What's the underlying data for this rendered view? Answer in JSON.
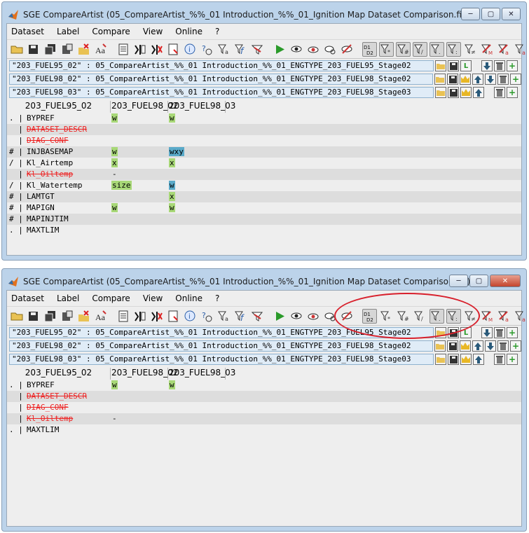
{
  "colors": {
    "added": "#a8d877",
    "changed": "#5aaac9",
    "removed": "#e22222",
    "highlight": "#d8202c"
  },
  "windows": [
    {
      "title": "SGE CompareArtist (05_CompareArtist_%%_01 Introduction_%%_01_Ignition Map Dataset Comparison.fig)",
      "menus": [
        "Dataset",
        "Label",
        "Compare",
        "View",
        "Online",
        "?"
      ],
      "datasets": [
        "\"203_FUEL95_02\" : 05_CompareArtist_%%_01 Introduction_%%_01_ENGTYPE_203_FUEL95_Stage02",
        "\"203_FUEL98_02\" : 05_CompareArtist_%%_01 Introduction_%%_01_ENGTYPE_203_FUEL98_Stage02",
        "\"203_FUEL98_03\" : 05_CompareArtist_%%_01 Introduction_%%_01_ENGTYPE_203_FUEL98_Stage03"
      ],
      "headers": [
        "203_FUEL95_02",
        "203_FUEL98_02",
        "203_FUEL98_03"
      ],
      "rows": [
        {
          "flag": ". |",
          "name": "BYPREF",
          "v1": "w",
          "v1c": "g",
          "v2": "w",
          "v2c": "g",
          "removed": false
        },
        {
          "flag": "  |",
          "name": "DATASET_DESCR",
          "v1": "",
          "v1c": "",
          "v2": "",
          "v2c": "",
          "removed": true
        },
        {
          "flag": "  |",
          "name": "DIAG_CONF",
          "v1": "",
          "v1c": "",
          "v2": "",
          "v2c": "",
          "removed": true
        },
        {
          "flag": "# |",
          "name": "INJBASEMAP",
          "v1": "w",
          "v1c": "g",
          "v2": "wxy",
          "v2c": "b",
          "removed": false
        },
        {
          "flag": "/ |",
          "name": "Kl_Airtemp",
          "v1": "x",
          "v1c": "g",
          "v2": "x",
          "v2c": "g",
          "removed": false
        },
        {
          "flag": "  |",
          "name": "Kl_Oiltemp",
          "v1": "-",
          "v1c": "",
          "v2": "",
          "v2c": "",
          "removed": true
        },
        {
          "flag": "/ |",
          "name": "Kl_Watertemp",
          "v1": "size",
          "v1c": "g",
          "v2": "w",
          "v2c": "b",
          "removed": false
        },
        {
          "flag": "# |",
          "name": "LAMTGT",
          "v1": "",
          "v1c": "",
          "v2": "x",
          "v2c": "g",
          "removed": false
        },
        {
          "flag": "# |",
          "name": "MAPIGN",
          "v1": "w",
          "v1c": "g",
          "v2": "w",
          "v2c": "g",
          "removed": false
        },
        {
          "flag": "# |",
          "name": "MAPINJTIM",
          "v1": "",
          "v1c": "",
          "v2": "",
          "v2c": "",
          "removed": false
        },
        {
          "flag": ". |",
          "name": "MAXTLIM",
          "v1": "",
          "v1c": "",
          "v2": "",
          "v2c": "",
          "removed": false
        }
      ]
    },
    {
      "title": "SGE CompareArtist (05_CompareArtist_%%_01 Introduction_%%_01_Ignition Map Dataset Comparison.fig)",
      "menus": [
        "Dataset",
        "Label",
        "Compare",
        "View",
        "Online",
        "?"
      ],
      "datasets": [
        "\"203_FUEL95_02\" : 05_CompareArtist_%%_01 Introduction_%%_01_ENGTYPE_203_FUEL95_Stage02",
        "\"203_FUEL98_02\" : 05_CompareArtist_%%_01 Introduction_%%_01_ENGTYPE_203_FUEL98_Stage02",
        "\"203_FUEL98_03\" : 05_CompareArtist_%%_01 Introduction_%%_01_ENGTYPE_203_FUEL98_Stage03"
      ],
      "headers": [
        "203_FUEL95_02",
        "203_FUEL98_02",
        "203_FUEL98_03"
      ],
      "rows": [
        {
          "flag": ". |",
          "name": "BYPREF",
          "v1": "w",
          "v1c": "g",
          "v2": "w",
          "v2c": "g",
          "removed": false
        },
        {
          "flag": "  |",
          "name": "DATASET_DESCR",
          "v1": "",
          "v1c": "",
          "v2": "",
          "v2c": "",
          "removed": true
        },
        {
          "flag": "  |",
          "name": "DIAG_CONF",
          "v1": "",
          "v1c": "",
          "v2": "",
          "v2c": "",
          "removed": true
        },
        {
          "flag": "  |",
          "name": "Kl_Oiltemp",
          "v1": "-",
          "v1c": "",
          "v2": "",
          "v2c": "",
          "removed": true
        },
        {
          "flag": ". |",
          "name": "MAXTLIM",
          "v1": "",
          "v1c": "",
          "v2": "",
          "v2c": "",
          "removed": false
        }
      ]
    }
  ]
}
